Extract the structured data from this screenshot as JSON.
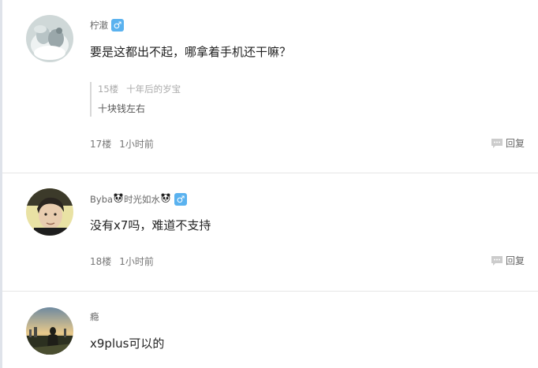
{
  "posts": [
    {
      "username": "柠澈",
      "gender": "♂",
      "content": "要是这都出不起，哪拿着手机还干嘛？",
      "quote": {
        "floor": "15楼",
        "author": "十年后的岁宝",
        "text": "十块钱左右"
      },
      "floor": "17楼",
      "time": "1小时前",
      "reply_label": "回复"
    },
    {
      "username_prefix": "Byba",
      "username_middle": "时光如水",
      "username_icons": [
        "panda-icon",
        "panda-icon"
      ],
      "gender": "♂",
      "content": "没有x7吗，难道不支持",
      "floor": "18楼",
      "time": "1小时前",
      "reply_label": "回复"
    },
    {
      "username": "瘾",
      "content": "x9plus可以的"
    }
  ],
  "colors": {
    "gender_badge": "#5ab2ef",
    "username": "#666666",
    "content": "#222222",
    "meta": "#777777",
    "quote_meta": "#aaaaaa",
    "divider": "#e6e6e6"
  }
}
